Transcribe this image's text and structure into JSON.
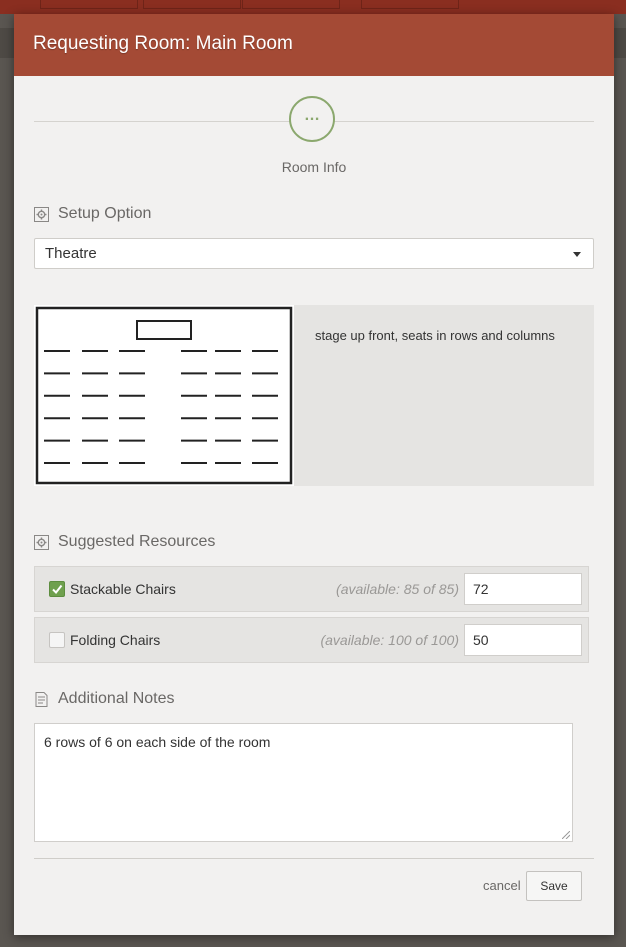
{
  "modal": {
    "title": "Requesting Room: Main Room",
    "accent_color": "#a44a35"
  },
  "stepper": {
    "step_icon": "…",
    "step_label": "Room Info",
    "step_color": "#8ba86e"
  },
  "setup": {
    "section_title": "Setup Option",
    "section_icon": "gear-icon",
    "selected": "Theatre",
    "description": "stage up front, seats in rows and columns",
    "layout_rows": 6,
    "layout_seats_per_side": 3
  },
  "resources": {
    "section_title": "Suggested Resources",
    "section_icon": "gear-icon",
    "items": [
      {
        "name": "Stackable Chairs",
        "available": "(available: 85 of 85)",
        "quantity": "72",
        "checked": true
      },
      {
        "name": "Folding Chairs",
        "available": "(available: 100 of 100)",
        "quantity": "50",
        "checked": false
      }
    ]
  },
  "notes": {
    "section_title": "Additional Notes",
    "section_icon": "document-icon",
    "value": "6 rows of 6 on each side of the room"
  },
  "footer": {
    "cancel_label": "cancel",
    "save_label": "Save"
  }
}
